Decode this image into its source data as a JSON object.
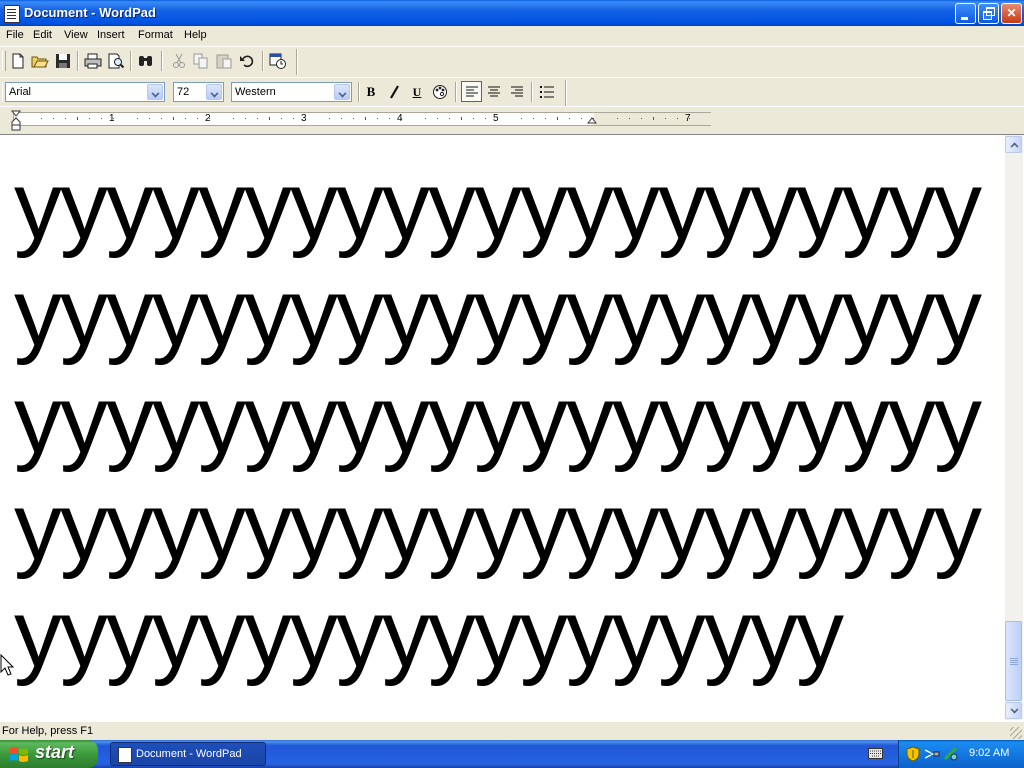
{
  "window": {
    "title": "Document - WordPad",
    "controls": {
      "minimize": "minimize",
      "maximize": "restore",
      "close": "close"
    }
  },
  "menu": [
    "File",
    "Edit",
    "View",
    "Insert",
    "Format",
    "Help"
  ],
  "toolbar": {
    "buttons": [
      "new-icon",
      "open-icon",
      "save-icon",
      "print-icon",
      "print-preview-icon",
      "find-icon",
      "cut-icon",
      "copy-icon",
      "paste-icon",
      "undo-icon",
      "date-time-icon"
    ]
  },
  "format_bar": {
    "font": "Arial",
    "size": "72",
    "script": "Western",
    "bold": "B",
    "italic": "I",
    "underline": "U"
  },
  "ruler": {
    "labels": [
      "1",
      "2",
      "3",
      "4",
      "5",
      "7"
    ]
  },
  "document": {
    "lines": [
      "yyyyyyyyyyyyyyyyyyyyy",
      "yyyyyyyyyyyyyyyyyyyyy",
      "yyyyyyyyyyyyyyyyyyyyy",
      "yyyyyyyyyyyyyyyyyyyyy",
      "yyyyyyyyyyyyyyyyyy"
    ]
  },
  "status": {
    "text": "For Help, press F1"
  },
  "taskbar": {
    "start_label": "start",
    "task_label": "Document - WordPad",
    "clock": "9:02 AM"
  },
  "colors": {
    "title_bar": "#0054E3",
    "chrome": "#ECE9D8",
    "start_button": "#3C9A3C",
    "taskbar": "#2663E0"
  }
}
